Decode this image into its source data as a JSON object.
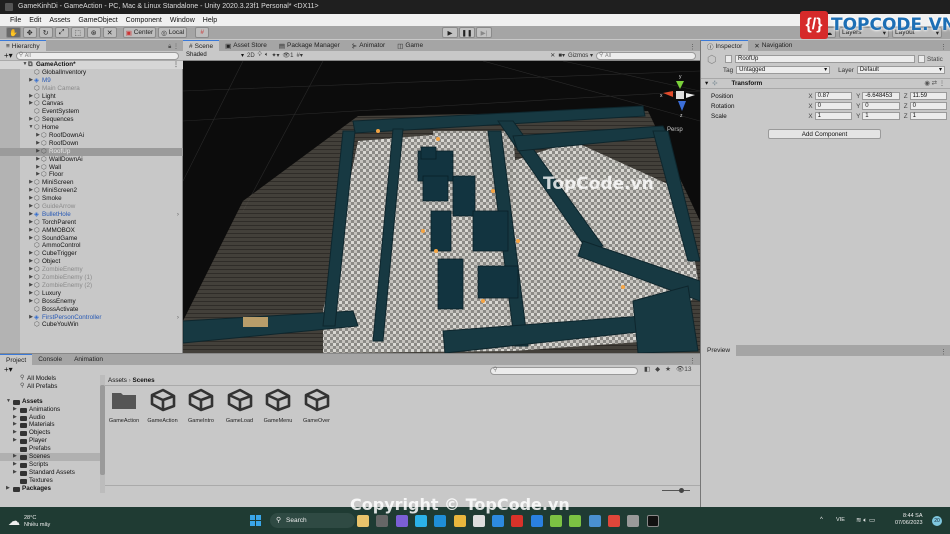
{
  "window": {
    "title": "GameKinhDi - GameAction - PC, Mac & Linux Standalone - Unity 2020.3.23f1 Personal* <DX11>"
  },
  "menu": [
    "File",
    "Edit",
    "Assets",
    "GameObject",
    "Component",
    "Window",
    "Help"
  ],
  "toolbar": {
    "tools": [
      "hand-tool",
      "move-tool",
      "rotate-tool",
      "scale-tool",
      "rect-tool",
      "transform-tool",
      "custom-tool"
    ],
    "pivot_label": "Center",
    "space_label": "Local",
    "play_buttons": [
      "play",
      "pause",
      "step"
    ],
    "layers_label": "Layers",
    "layout_label": "Layout"
  },
  "hierarchy": {
    "tab_label": "Hierarchy",
    "search_placeholder": "All",
    "scene_name": "GameAction*",
    "items": [
      {
        "label": "GlobalInventory",
        "depth": 1,
        "arrow": false,
        "state": "normal"
      },
      {
        "label": "M9",
        "depth": 1,
        "arrow": true,
        "state": "blue"
      },
      {
        "label": "Main Camera",
        "depth": 1,
        "arrow": false,
        "state": "dim"
      },
      {
        "label": "Light",
        "depth": 1,
        "arrow": true,
        "state": "normal"
      },
      {
        "label": "Canvas",
        "depth": 1,
        "arrow": true,
        "state": "normal"
      },
      {
        "label": "EventSystem",
        "depth": 1,
        "arrow": false,
        "state": "normal"
      },
      {
        "label": "Sequences",
        "depth": 1,
        "arrow": true,
        "state": "normal"
      },
      {
        "label": "Home",
        "depth": 1,
        "arrow": true,
        "expanded": true,
        "state": "normal"
      },
      {
        "label": "RoofDownAi",
        "depth": 2,
        "arrow": true,
        "state": "normal"
      },
      {
        "label": "RoofDown",
        "depth": 2,
        "arrow": true,
        "state": "normal"
      },
      {
        "label": "RoofUp",
        "depth": 2,
        "arrow": true,
        "state": "selected"
      },
      {
        "label": "WallDownAi",
        "depth": 2,
        "arrow": true,
        "state": "normal"
      },
      {
        "label": "Wall",
        "depth": 2,
        "arrow": true,
        "state": "normal"
      },
      {
        "label": "Floor",
        "depth": 2,
        "arrow": true,
        "state": "normal"
      },
      {
        "label": "MiniScreen",
        "depth": 1,
        "arrow": true,
        "state": "normal"
      },
      {
        "label": "MiniScreen2",
        "depth": 1,
        "arrow": true,
        "state": "normal"
      },
      {
        "label": "Smoke",
        "depth": 1,
        "arrow": true,
        "state": "normal"
      },
      {
        "label": "GuideArrow",
        "depth": 1,
        "arrow": true,
        "state": "dim"
      },
      {
        "label": "BulletHole",
        "depth": 1,
        "arrow": true,
        "state": "blue",
        "more": true
      },
      {
        "label": "TorchParent",
        "depth": 1,
        "arrow": true,
        "state": "normal"
      },
      {
        "label": "AMMOBOX",
        "depth": 1,
        "arrow": true,
        "state": "normal"
      },
      {
        "label": "SoundGame",
        "depth": 1,
        "arrow": true,
        "state": "normal"
      },
      {
        "label": "AmmoControl",
        "depth": 1,
        "arrow": false,
        "state": "normal"
      },
      {
        "label": "CubeTrigger",
        "depth": 1,
        "arrow": true,
        "state": "normal"
      },
      {
        "label": "Object",
        "depth": 1,
        "arrow": true,
        "state": "normal"
      },
      {
        "label": "ZombieEnemy",
        "depth": 1,
        "arrow": true,
        "state": "dim"
      },
      {
        "label": "ZombieEnemy (1)",
        "depth": 1,
        "arrow": true,
        "state": "dim"
      },
      {
        "label": "ZombieEnemy (2)",
        "depth": 1,
        "arrow": true,
        "state": "dim"
      },
      {
        "label": "Luxury",
        "depth": 1,
        "arrow": true,
        "state": "normal"
      },
      {
        "label": "BossEnemy",
        "depth": 1,
        "arrow": true,
        "state": "normal"
      },
      {
        "label": "BossActivate",
        "depth": 1,
        "arrow": false,
        "state": "normal"
      },
      {
        "label": "FirstPersonController",
        "depth": 1,
        "arrow": true,
        "state": "blue",
        "more": true
      },
      {
        "label": "CubeYouWin",
        "depth": 1,
        "arrow": false,
        "state": "normal"
      }
    ]
  },
  "scene": {
    "tabs": [
      {
        "label": "Scene",
        "icon": "#",
        "active": true
      },
      {
        "label": "Asset Store",
        "icon": "▣",
        "active": false
      },
      {
        "label": "Package Manager",
        "icon": "▤",
        "active": false
      },
      {
        "label": "Animator",
        "icon": "⊱",
        "active": false
      },
      {
        "label": "Game",
        "icon": "◫",
        "active": false
      }
    ],
    "shading_mode": "Shaded",
    "mode_2d": "2D",
    "hidden_count": "1",
    "gizmos_label": "Gizmos",
    "search_placeholder": "All",
    "projection_label": "Persp",
    "axis_labels": {
      "x": "x",
      "y": "y",
      "z": "z"
    }
  },
  "inspector": {
    "tabs": [
      {
        "label": "Inspector",
        "icon": "ⓘ",
        "active": true
      },
      {
        "label": "Navigation",
        "icon": "✕",
        "active": false
      }
    ],
    "object_name": "RoofUp",
    "static_label": "Static",
    "tag_label": "Tag",
    "tag_value": "Untagged",
    "layer_label": "Layer",
    "layer_value": "Default",
    "transform": {
      "title": "Transform",
      "rows": [
        {
          "label": "Position",
          "x": "0.87",
          "y": "-6.648453",
          "z": "11.59"
        },
        {
          "label": "Rotation",
          "x": "0",
          "y": "0",
          "z": "0"
        },
        {
          "label": "Scale",
          "x": "1",
          "y": "1",
          "z": "1"
        }
      ]
    },
    "add_component_label": "Add Component"
  },
  "preview": {
    "tab_label": "Preview"
  },
  "project": {
    "tabs": [
      {
        "label": "Project",
        "active": true
      },
      {
        "label": "Console",
        "active": false
      },
      {
        "label": "Animation",
        "active": false
      }
    ],
    "favorites": [
      "All Models",
      "All Prefabs"
    ],
    "tree": [
      {
        "label": "Assets",
        "depth": 0,
        "arrow": true,
        "expanded": true,
        "bold": true
      },
      {
        "label": "Animations",
        "depth": 1,
        "arrow": true
      },
      {
        "label": "Audio",
        "depth": 1,
        "arrow": true
      },
      {
        "label": "Materials",
        "depth": 1,
        "arrow": true
      },
      {
        "label": "Objects",
        "depth": 1,
        "arrow": true
      },
      {
        "label": "Player",
        "depth": 1,
        "arrow": true
      },
      {
        "label": "Prefabs",
        "depth": 1,
        "arrow": false
      },
      {
        "label": "Scenes",
        "depth": 1,
        "arrow": true,
        "selected": true
      },
      {
        "label": "Scripts",
        "depth": 1,
        "arrow": true
      },
      {
        "label": "Standard Assets",
        "depth": 1,
        "arrow": true
      },
      {
        "label": "Textures",
        "depth": 1,
        "arrow": false
      },
      {
        "label": "Packages",
        "depth": 0,
        "arrow": true,
        "bold": true
      }
    ],
    "breadcrumb": [
      "Assets",
      "Scenes"
    ],
    "hidden_count": "13",
    "assets": [
      {
        "label": "GameAction",
        "type": "folder"
      },
      {
        "label": "GameAction",
        "type": "scene"
      },
      {
        "label": "GameIntro",
        "type": "scene"
      },
      {
        "label": "GameLoad",
        "type": "scene"
      },
      {
        "label": "GameMenu",
        "type": "scene"
      },
      {
        "label": "GameOver",
        "type": "scene"
      }
    ],
    "thumbnail_zoom": 0.7
  },
  "taskbar": {
    "weather_temp": "28°C",
    "weather_desc": "Nhiều mây",
    "search_label": "Search",
    "language": "VIE",
    "time": "8:44 SA",
    "date": "07/06/2023",
    "notification_count": "20",
    "apps": [
      "widgets",
      "task-view",
      "teams",
      "screen",
      "edge",
      "file-explorer",
      "store",
      "mail",
      "wps",
      "safari",
      "app-green-1",
      "app-green-2",
      "notepad",
      "chrome",
      "unity-hub",
      "unity"
    ],
    "mail_badge": "55"
  },
  "watermarks": {
    "center": "TopCode.vn",
    "bottom": "Copyright © TopCode.vn",
    "logo": "TOPCODE.VN",
    "logo_mark": "{/}"
  }
}
